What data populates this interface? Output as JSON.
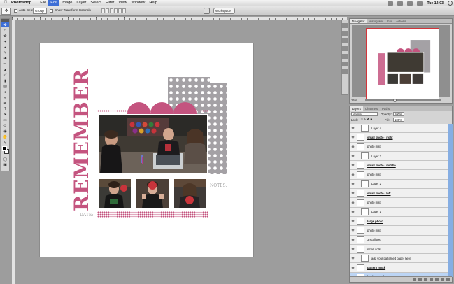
{
  "menubar": {
    "app_name": "Photoshop",
    "items": [
      "File",
      "Edit",
      "Image",
      "Layer",
      "Select",
      "Filter",
      "View",
      "Window",
      "Help"
    ],
    "active_item": "Edit",
    "clock": "Tue 12:03"
  },
  "options_bar": {
    "auto_select_label": "Auto-Select:",
    "auto_select_value": "Group",
    "transform_label": "Show Transform Controls",
    "workspace_label": "Workspace"
  },
  "scrapbook": {
    "title_word": "REMEMBER",
    "date_label": "DATE:",
    "notes_label": "NOTES:",
    "accent_color": "#c4547f",
    "pattern_color": "#a4a1a5"
  },
  "navigator": {
    "tabs": [
      "Navigator",
      "Histogram",
      "Info",
      "Actions"
    ],
    "zoom": "25%"
  },
  "layers_panel": {
    "tabs": [
      "Layers",
      "Channels",
      "Paths"
    ],
    "blend_mode": "Normal",
    "opacity_label": "Opacity:",
    "opacity_value": "100%",
    "lock_label": "Lock:",
    "fill_label": "Fill:",
    "fill_value": "100%",
    "layers": [
      {
        "name": "Layer 4",
        "kind": "clip"
      },
      {
        "name": "small photo - right",
        "kind": "base"
      },
      {
        "name": "photo mat",
        "kind": "plain"
      },
      {
        "name": "Layer 3",
        "kind": "clip"
      },
      {
        "name": "small photo - middle",
        "kind": "base"
      },
      {
        "name": "photo mat",
        "kind": "plain"
      },
      {
        "name": "Layer 2",
        "kind": "clip"
      },
      {
        "name": "small photo - left",
        "kind": "base"
      },
      {
        "name": "photo mat",
        "kind": "plain"
      },
      {
        "name": "Layer 1",
        "kind": "clip"
      },
      {
        "name": "large photo",
        "kind": "base"
      },
      {
        "name": "photo mat",
        "kind": "plain"
      },
      {
        "name": "3 scallops",
        "kind": "plain"
      },
      {
        "name": "small dots",
        "kind": "plain"
      },
      {
        "name": "add your patterned paper here",
        "kind": "clip"
      },
      {
        "name": "pattern mask",
        "kind": "base"
      },
      {
        "name": "background paper",
        "kind": "selected"
      }
    ]
  }
}
